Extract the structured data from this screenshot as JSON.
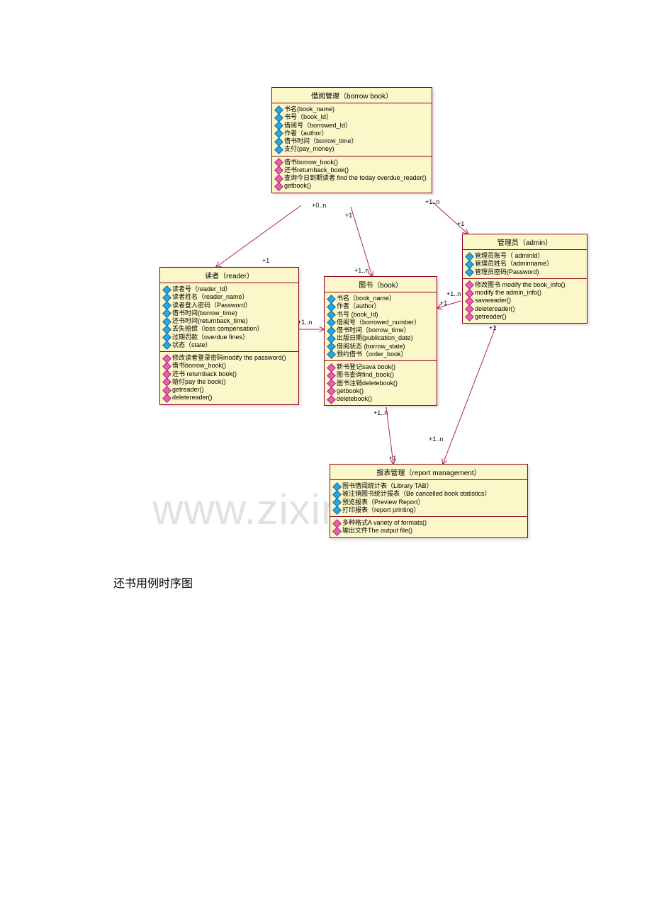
{
  "caption": "还书用例时序图",
  "watermark": "www.zixin.com.cn",
  "classes": {
    "borrow": {
      "title": "借阅管理（borrow book）",
      "attrs": [
        "书名(book_name)",
        "书号（book_Id）",
        "借阅号（borrowed_Id）",
        "作者（author）",
        "借书时间（borrow_time）",
        "支付(pay_money)"
      ],
      "ops": [
        "借书borrow_book()",
        "还书returnback_book()",
        "查询今日到期读者 find the today overdue_reader()",
        "getbook()"
      ]
    },
    "reader": {
      "title": "读者（reader）",
      "attrs": [
        "读者号（reader_Id）",
        "读者姓名（reader_name）",
        "读者登入密码（Password）",
        "借书时间(borrow_time)",
        "还书时间(returnback_time)",
        "丢失赔偿（loss compensation）",
        "过期罚款（overdue fines）",
        "状态（state）"
      ],
      "ops": [
        "修改读者登录密码modify the password()",
        "借书borrow_book()",
        "还书 returnback book()",
        "赔付pay the book()",
        "getreader()",
        "deletereader()"
      ]
    },
    "book": {
      "title": "图书（book）",
      "attrs": [
        "书名（book_name）",
        "作者（author）",
        "书号 (book_Id)",
        "借阅号（borrowed_number）",
        "借书时间（borrow_time）",
        "出版日期(publication_date)",
        "借阅状态 (borrow_state)",
        "预约借书（order_book）"
      ],
      "ops": [
        "新书登记sava book()",
        "图书查询find_book()",
        "图书注销deletebook()",
        "getbook()",
        "deletebook()"
      ]
    },
    "admin": {
      "title": "管理员（admin）",
      "attrs": [
        "管理员账号（ adminId）",
        "管理员姓名（adminname）",
        "管理员密码(Password)"
      ],
      "ops": [
        "修改图书 modify the book_info()",
        "modify the admin_info()",
        "savareader()",
        "deletereader()",
        "getreader()"
      ]
    },
    "report": {
      "title": "报表管理（report management）",
      "attrs": [
        "图书借阅统计表（Library TAB）",
        "被注销图书统计报表（Be cancelled book statistics）",
        "预览报表（Preview Report）",
        "打印报表（report printing）"
      ],
      "ops": [
        "多种格式A variety of formats()",
        "输出文件The output file()"
      ]
    }
  },
  "mult": {
    "m1": "+0..n",
    "m2": "+1",
    "m3": "+1..n",
    "m4": "+1",
    "m5": "+1..n",
    "m6": "+1",
    "m7": "+1..n",
    "m8": "+1",
    "m9": "+1..n",
    "m10": "+1",
    "m11": "+1..n",
    "m12": "+1",
    "m13": "+1..n",
    "m14": "+1"
  }
}
